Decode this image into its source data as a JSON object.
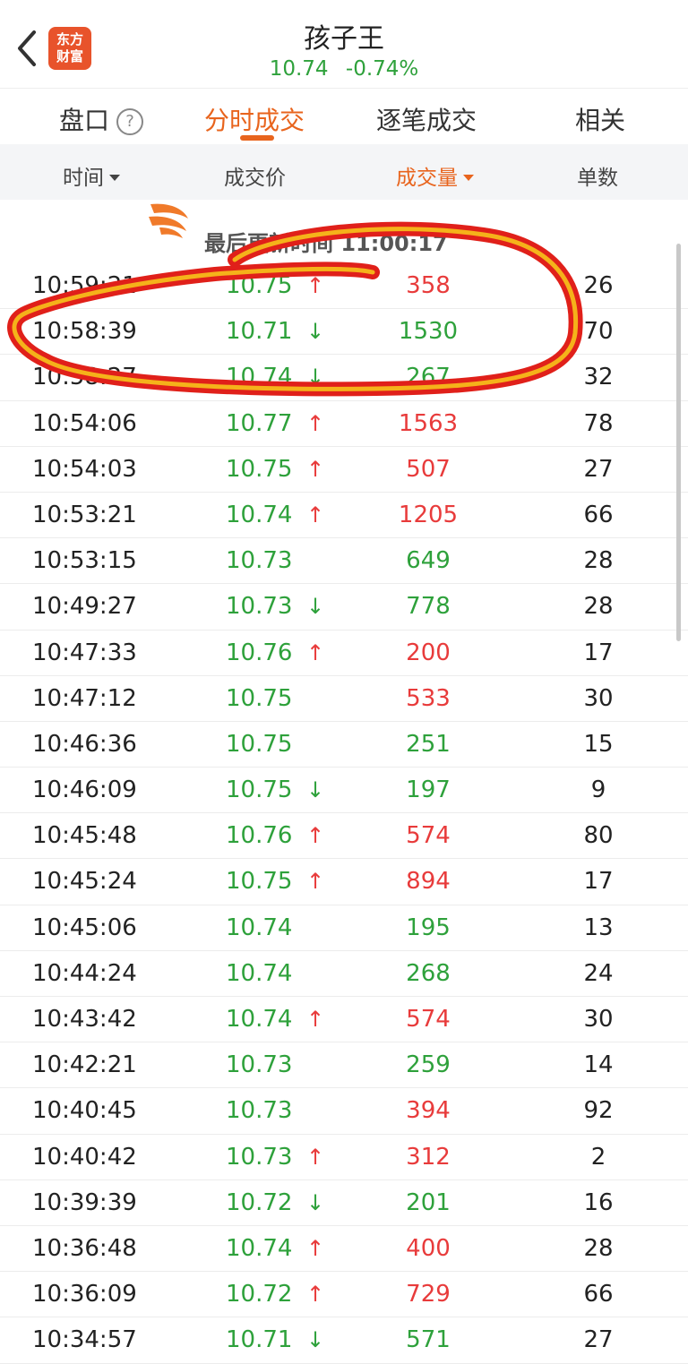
{
  "header": {
    "title": "孩子王",
    "price": "10.74",
    "change_pct": "-0.74%",
    "logo_line1": "东方",
    "logo_line2": "财富"
  },
  "tabs": [
    {
      "label": "盘口",
      "active": false
    },
    {
      "label": "分时成交",
      "active": true
    },
    {
      "label": "逐笔成交",
      "active": false
    },
    {
      "label": "相关",
      "active": false
    }
  ],
  "help_icon_text": "?",
  "columns": {
    "time": "时间",
    "price": "成交价",
    "volume": "成交量",
    "count": "单数"
  },
  "banner": {
    "text": "最后更新时间 11:00:17"
  },
  "rows": [
    {
      "time": "10:59:21",
      "price": "10.75",
      "dir": "up",
      "volume": "358",
      "vol_color": "up",
      "count": "26"
    },
    {
      "time": "10:58:39",
      "price": "10.71",
      "dir": "down",
      "volume": "1530",
      "vol_color": "down",
      "count": "70"
    },
    {
      "time": "10:58:27",
      "price": "10.74",
      "dir": "down",
      "volume": "267",
      "vol_color": "down",
      "count": "32"
    },
    {
      "time": "10:54:06",
      "price": "10.77",
      "dir": "up",
      "volume": "1563",
      "vol_color": "up",
      "count": "78"
    },
    {
      "time": "10:54:03",
      "price": "10.75",
      "dir": "up",
      "volume": "507",
      "vol_color": "up",
      "count": "27"
    },
    {
      "time": "10:53:21",
      "price": "10.74",
      "dir": "up",
      "volume": "1205",
      "vol_color": "up",
      "count": "66"
    },
    {
      "time": "10:53:15",
      "price": "10.73",
      "dir": "",
      "volume": "649",
      "vol_color": "down",
      "count": "28"
    },
    {
      "time": "10:49:27",
      "price": "10.73",
      "dir": "down",
      "volume": "778",
      "vol_color": "down",
      "count": "28"
    },
    {
      "time": "10:47:33",
      "price": "10.76",
      "dir": "up",
      "volume": "200",
      "vol_color": "up",
      "count": "17"
    },
    {
      "time": "10:47:12",
      "price": "10.75",
      "dir": "",
      "volume": "533",
      "vol_color": "up",
      "count": "30"
    },
    {
      "time": "10:46:36",
      "price": "10.75",
      "dir": "",
      "volume": "251",
      "vol_color": "down",
      "count": "15"
    },
    {
      "time": "10:46:09",
      "price": "10.75",
      "dir": "down",
      "volume": "197",
      "vol_color": "down",
      "count": "9"
    },
    {
      "time": "10:45:48",
      "price": "10.76",
      "dir": "up",
      "volume": "574",
      "vol_color": "up",
      "count": "80"
    },
    {
      "time": "10:45:24",
      "price": "10.75",
      "dir": "up",
      "volume": "894",
      "vol_color": "up",
      "count": "17"
    },
    {
      "time": "10:45:06",
      "price": "10.74",
      "dir": "",
      "volume": "195",
      "vol_color": "down",
      "count": "13"
    },
    {
      "time": "10:44:24",
      "price": "10.74",
      "dir": "",
      "volume": "268",
      "vol_color": "down",
      "count": "24"
    },
    {
      "time": "10:43:42",
      "price": "10.74",
      "dir": "up",
      "volume": "574",
      "vol_color": "up",
      "count": "30"
    },
    {
      "time": "10:42:21",
      "price": "10.73",
      "dir": "",
      "volume": "259",
      "vol_color": "down",
      "count": "14"
    },
    {
      "time": "10:40:45",
      "price": "10.73",
      "dir": "",
      "volume": "394",
      "vol_color": "up",
      "count": "92"
    },
    {
      "time": "10:40:42",
      "price": "10.73",
      "dir": "up",
      "volume": "312",
      "vol_color": "up",
      "count": "2"
    },
    {
      "time": "10:39:39",
      "price": "10.72",
      "dir": "down",
      "volume": "201",
      "vol_color": "down",
      "count": "16"
    },
    {
      "time": "10:36:48",
      "price": "10.74",
      "dir": "up",
      "volume": "400",
      "vol_color": "up",
      "count": "28"
    },
    {
      "time": "10:36:09",
      "price": "10.72",
      "dir": "up",
      "volume": "729",
      "vol_color": "up",
      "count": "66"
    },
    {
      "time": "10:34:57",
      "price": "10.71",
      "dir": "down",
      "volume": "571",
      "vol_color": "down",
      "count": "27"
    }
  ],
  "colors": {
    "accent": "#e8641d",
    "up": "#e83b3b",
    "down": "#2ea13b",
    "logo_bg": "#e8532b",
    "scribble": "#e0201a"
  },
  "icons": {
    "back": "chevron-left-icon",
    "up_arrow": "↑",
    "down_arrow": "↓"
  }
}
